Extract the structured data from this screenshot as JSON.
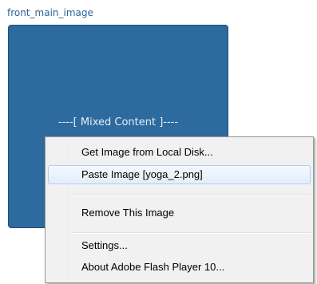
{
  "field": {
    "label": "front_main_image",
    "placeholder_text": "----[ Mixed Content ]----"
  },
  "colors": {
    "label_text": "#2a6496",
    "image_box_bg": "#2d6a9e",
    "menu_bg": "#f1f1f1",
    "menu_highlight_border": "#aecff7"
  },
  "context_menu": {
    "items": [
      {
        "label": "Get Image from Local Disk..."
      },
      {
        "label": "Paste Image [yoga_2.png]",
        "highlighted": true
      },
      {
        "label": "Remove This Image"
      },
      {
        "label": "Settings..."
      },
      {
        "label": "About Adobe Flash Player 10..."
      }
    ]
  }
}
